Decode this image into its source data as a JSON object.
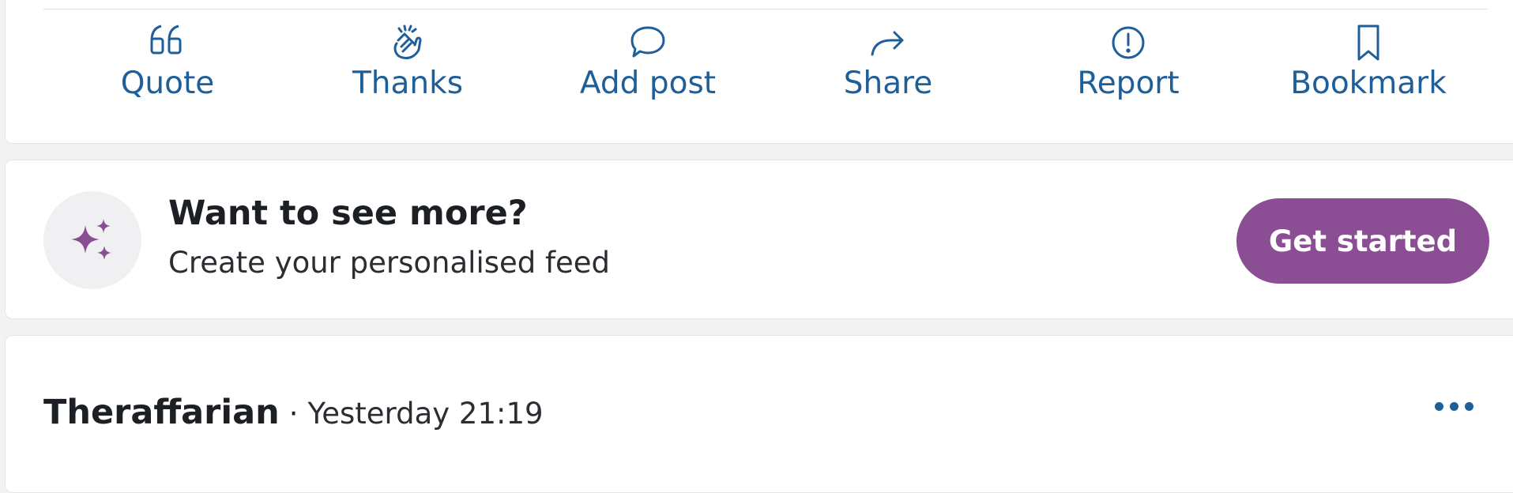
{
  "actions": [
    {
      "label": "Quote",
      "icon": "quote-icon"
    },
    {
      "label": "Thanks",
      "icon": "clap-icon"
    },
    {
      "label": "Add post",
      "icon": "chat-bubble-icon"
    },
    {
      "label": "Share",
      "icon": "share-arrow-icon"
    },
    {
      "label": "Report",
      "icon": "alert-circle-icon"
    },
    {
      "label": "Bookmark",
      "icon": "bookmark-icon"
    }
  ],
  "promo": {
    "title": "Want to see more?",
    "subtitle": "Create your personalised feed",
    "cta_label": "Get started",
    "icon": "sparkles-icon"
  },
  "post": {
    "author": "Theraffarian",
    "separator": "·",
    "time": "Yesterday 21:19",
    "menu_icon": "more-dots-icon"
  },
  "colors": {
    "link_blue": "#1f5f99",
    "brand_purple": "#8b4d93",
    "page_bg": "#f1f2f4",
    "card_bg": "#ffffff"
  }
}
